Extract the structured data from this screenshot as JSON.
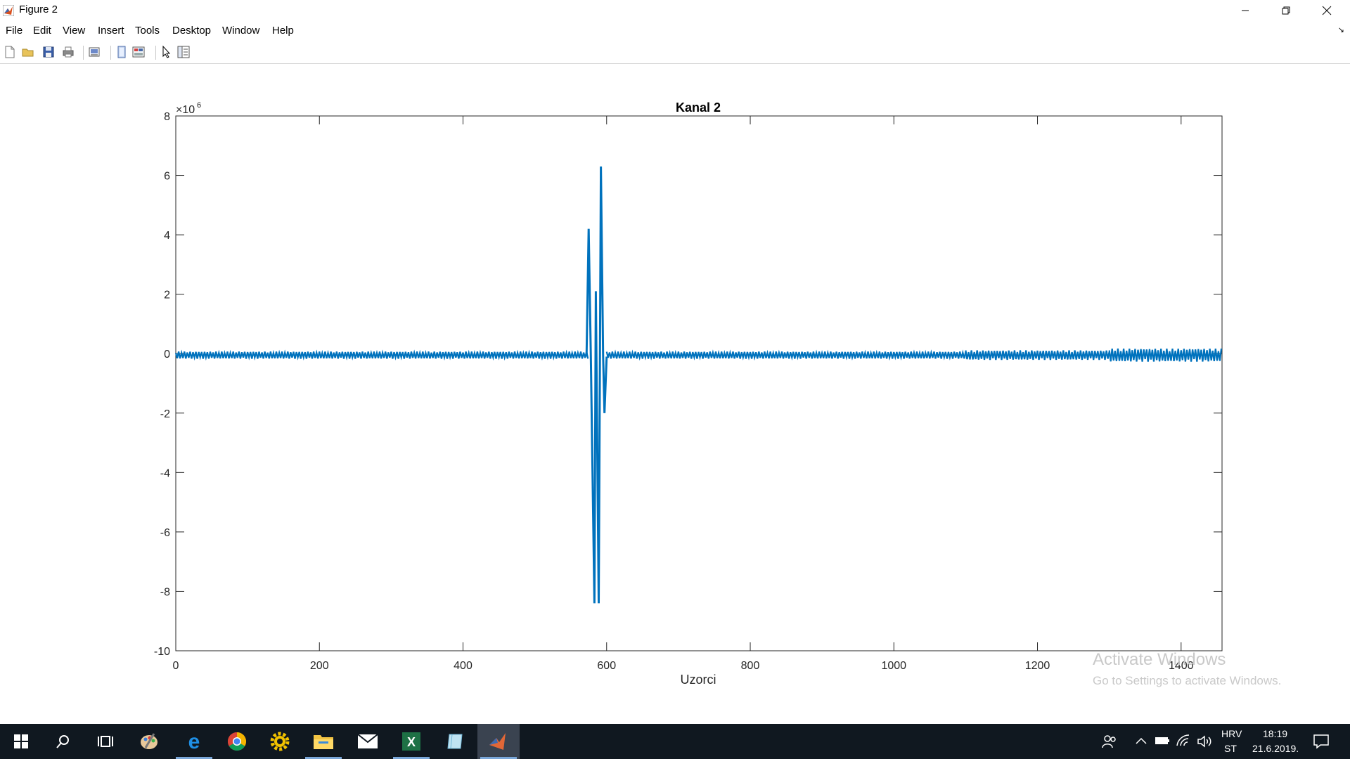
{
  "window": {
    "title": "Figure 2",
    "minimize_icon": "minimize-icon",
    "restore_icon": "restore-icon",
    "close_icon": "close-icon"
  },
  "menu": {
    "items": [
      "File",
      "Edit",
      "View",
      "Insert",
      "Tools",
      "Desktop",
      "Window",
      "Help"
    ]
  },
  "toolbar": {
    "buttons": [
      "new-figure-icon",
      "open-file-icon",
      "save-icon",
      "print-icon",
      "link-plot-icon",
      "hide-plot-tools-icon",
      "show-plot-tools-icon",
      "edit-plot-icon",
      "plot-browser-icon"
    ]
  },
  "colors": {
    "line": "#0072BD",
    "taskbar": "#101820",
    "watermark": "#c9c9c9"
  },
  "chart_data": {
    "type": "line",
    "title": "Kanal 2",
    "xlabel": "Uzorci",
    "ylabel": "",
    "exponent_label": "×10",
    "exponent_power": "6",
    "xlim": [
      0,
      1457
    ],
    "ylim": [
      -10,
      8
    ],
    "xticks": [
      0,
      200,
      400,
      600,
      800,
      1000,
      1200,
      1400
    ],
    "yticks": [
      -10,
      -8,
      -6,
      -4,
      -2,
      0,
      2,
      4,
      6,
      8
    ],
    "x_tick_labels": [
      "0",
      "200",
      "400",
      "600",
      "800",
      "1000",
      "1200",
      "1400"
    ],
    "y_tick_labels": [
      "-10",
      "-8",
      "-6",
      "-4",
      "-2",
      "0",
      "2",
      "4",
      "6",
      "8"
    ],
    "grid": false,
    "series": [
      {
        "baseline": -0.05,
        "noise_band": [
          {
            "x_start": 0,
            "x_end": 575,
            "amplitude": 0.12
          },
          {
            "x_start": 600,
            "x_end": 1100,
            "amplitude": 0.12
          },
          {
            "x_start": 1100,
            "x_end": 1300,
            "amplitude": 0.16
          },
          {
            "x_start": 1300,
            "x_end": 1457,
            "amplitude": 0.22
          }
        ],
        "spike_points": [
          [
            572,
            -0.1
          ],
          [
            575,
            4.2
          ],
          [
            578,
            -0.1
          ],
          [
            583,
            -8.4
          ],
          [
            585,
            2.1
          ],
          [
            589,
            -8.4
          ],
          [
            592,
            6.3
          ],
          [
            595,
            0.0
          ],
          [
            597,
            -2.0
          ],
          [
            600,
            -0.1
          ]
        ]
      }
    ]
  },
  "watermark": {
    "line1": "Activate Windows",
    "line2": "Go to Settings to activate Windows."
  },
  "taskbar": {
    "apps": [
      "windows-start-icon",
      "search-icon",
      "task-view-icon",
      "paint-icon",
      "edge-icon",
      "chrome-icon",
      "settings-gear-app-icon",
      "file-explorer-icon",
      "mail-icon",
      "excel-icon",
      "notes-app-icon",
      "matlab-icon"
    ],
    "language": "HRV",
    "layout": "ST",
    "time": "18:19",
    "date": "21.6.2019."
  }
}
